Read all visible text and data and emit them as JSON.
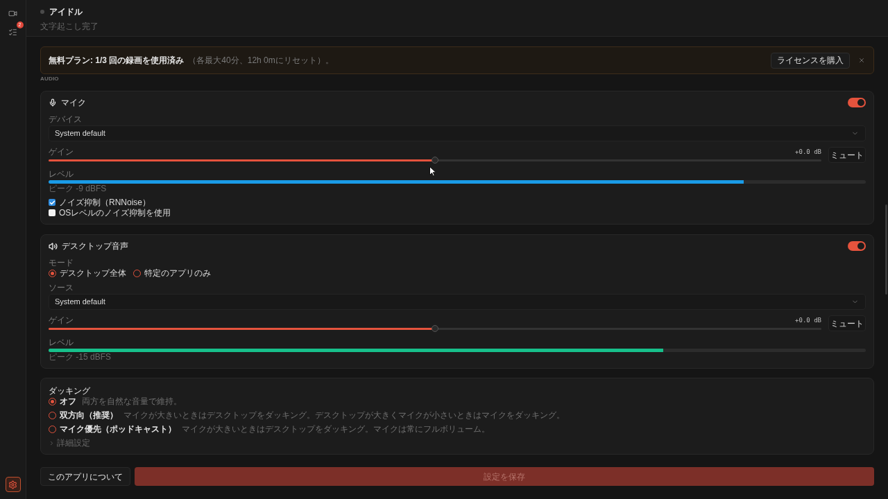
{
  "sidebar": {
    "items": [
      {
        "selected": false
      },
      {
        "selected": false,
        "badge": "2"
      },
      {
        "selected": true
      }
    ]
  },
  "header": {
    "status": "アイドル",
    "subtitle": "文字起こし完了"
  },
  "banner": {
    "title": "無料プラン: 1/3 回の録画を使用済み",
    "note": "（各最大40分、12h 0mにリセット）。",
    "button": "ライセンスを購入"
  },
  "section_label": "AUDIO",
  "channels": [
    {
      "kind": "mic",
      "title": "マイク",
      "enabled": true,
      "select_label": "デバイス",
      "select_value": "System default",
      "gain_label": "ゲイン",
      "gain": {
        "level": 0.5,
        "reading": "+0.0 dB"
      },
      "mute_button": "ミュート",
      "meter_label": "レベル",
      "meter": {
        "level": 0.851,
        "color": "#1a9be6"
      },
      "peak": "ピーク -9 dBFS",
      "options": [
        {
          "label": "ノイズ抑制（RNNoise）",
          "checked": true
        },
        {
          "label": "OSレベルのノイズ抑制を使用",
          "checked": false
        }
      ]
    },
    {
      "kind": "desktop",
      "title": "デスクトップ音声",
      "enabled": true,
      "mode_label": "モード",
      "modes": [
        {
          "label": "デスクトップ全体",
          "selected": true
        },
        {
          "label": "特定のアプリのみ",
          "selected": false
        }
      ],
      "select_label": "ソース",
      "select_value": "System default",
      "gain_label": "ゲイン",
      "gain": {
        "level": 0.5,
        "reading": "+0.0 dB"
      },
      "mute_button": "ミュート",
      "meter_label": "レベル",
      "meter": {
        "level": 0.752,
        "color": "#17c08b"
      },
      "peak": "ピーク -15 dBFS"
    }
  ],
  "ducking": {
    "title": "ダッキング",
    "options": [
      {
        "label": "オフ",
        "description": "両方を自然な音量で維持。",
        "selected": true
      },
      {
        "label": "双方向（推奨）",
        "description": "マイクが大きいときはデスクトップをダッキング。デスクトップが大きくマイクが小さいときはマイクをダッキング。",
        "selected": false
      },
      {
        "label": "マイク優先（ポッドキャスト）",
        "description": "マイクが大きいときはデスクトップをダッキング。マイクは常にフルボリューム。",
        "selected": false
      }
    ],
    "advanced": {
      "label": "詳細設定",
      "expanded": false
    }
  },
  "footer": {
    "about_button": "このアプリについて",
    "save_button": {
      "label": "設定を保存",
      "disabled": true
    }
  }
}
